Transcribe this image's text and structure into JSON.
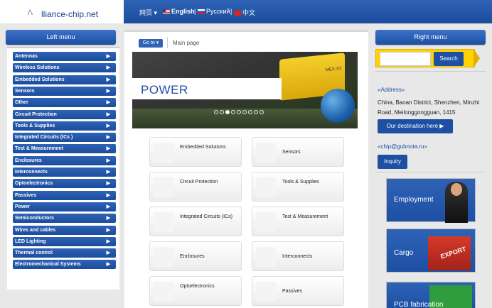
{
  "header": {
    "logo_text": "lliance-chip.net",
    "languages": [
      {
        "label": "网页 ▾"
      },
      {
        "label": "English"
      },
      {
        "label": "Русский"
      },
      {
        "label": "中文"
      }
    ]
  },
  "left": {
    "title": "Left menu",
    "items": [
      "Antennas",
      "Wireless Solutions",
      "Embedded Solutions",
      "Sensors",
      "Other",
      "Circuit Protection",
      "Tools & Supplies",
      "Integrated Circuits (ICs )",
      "Test & Measurement",
      "Enclosures",
      "Interconnects",
      "Optoelectronics",
      "Passives",
      "Power",
      "Semiconductors",
      "Wires and cables",
      "LED Lighting",
      "Thermal control",
      "Electromechanical Systems"
    ],
    "arrow": "▶"
  },
  "center": {
    "goto": "Go to ▾",
    "breadcrumb": "Main page",
    "banner_text": "POWER",
    "banner_cap_label": "MEX-X2",
    "slides": 9,
    "active_slide": 2,
    "categories": [
      {
        "label": "Embedded Solutions",
        "icon": "embedded-board-icon"
      },
      {
        "label": "Sensors",
        "icon": "sensor-icon"
      },
      {
        "label": "Circuit Protection",
        "icon": "relay-icon"
      },
      {
        "label": "Tools & Supplies",
        "icon": "tool-icon"
      },
      {
        "label": "Integrated Circuits (ICs)",
        "icon": "ic-chip-icon"
      },
      {
        "label": "Test & Measurement",
        "icon": "multimeter-icon"
      },
      {
        "label": "Enclosures",
        "icon": "enclosure-icon"
      },
      {
        "label": "Interconnects",
        "icon": "connector-icon"
      },
      {
        "label": "Optoelectronics",
        "icon": "optoelectronic-icon"
      },
      {
        "label": "Passives",
        "icon": "passive-component-icon"
      }
    ]
  },
  "right": {
    "title": "Right menu",
    "search_label": "Search",
    "address_title": "«Address»",
    "address": "China, Baoan District, Shenzhen, Minzhi Road, Meilonggongguan, 1415",
    "destination": "Our destination here ▶",
    "email": "«chip@gubnota.ru»",
    "inquiry": "Inquiry",
    "promos": [
      {
        "label": "Employment"
      },
      {
        "label": "Cargo",
        "extra": "EXPORT"
      },
      {
        "label": "PCB fabrication"
      }
    ]
  },
  "colors": {
    "accent": "#1d4fa3",
    "search_bg": "#ffd200"
  }
}
